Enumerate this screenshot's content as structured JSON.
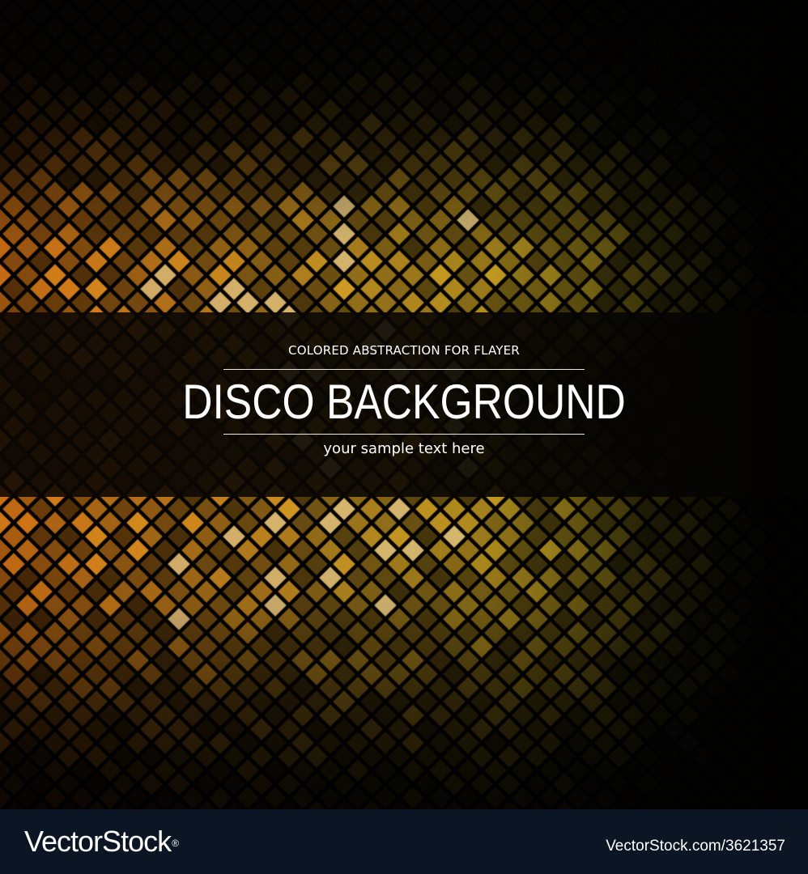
{
  "artwork": {
    "overline": "COLORED ABSTRACTION FOR FLAYER",
    "headline": "DISCO BACKGROUND",
    "subline": "your sample text here",
    "colors": {
      "background": "#000000",
      "tile_orange": "#ff8a1a",
      "tile_gold": "#f2b42a",
      "tile_olive": "#b5a21e",
      "tile_highlight": "#ffe6b0",
      "grid_lines": "#000000",
      "banner": "#0b0703",
      "footer": "#0c1524",
      "text": "#ffffff"
    }
  },
  "footer": {
    "brand": "VectorStock",
    "brand_mark": "®",
    "image_ref": "VectorStock.com/3621357"
  }
}
